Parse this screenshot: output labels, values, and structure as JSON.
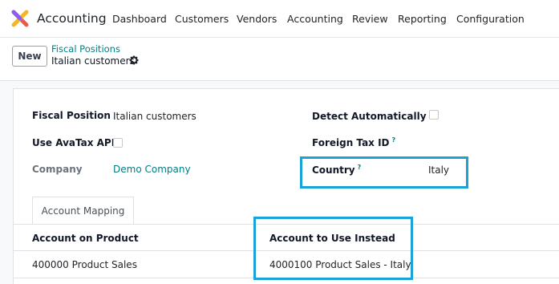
{
  "navbar": {
    "app_name": "Accounting",
    "menu": [
      "Dashboard",
      "Customers",
      "Vendors",
      "Accounting",
      "Review",
      "Reporting",
      "Configuration"
    ]
  },
  "control": {
    "new_label": "New",
    "breadcrumb_parent": "Fiscal Positions",
    "breadcrumb_current": "Italian customers"
  },
  "form": {
    "fiscal_position_label": "Fiscal Position",
    "fiscal_position_value": "Italian customers",
    "use_avatax_label": "Use AvaTax API",
    "company_label": "Company",
    "company_value": "Demo Company",
    "detect_auto_label": "Detect Automatically",
    "foreign_tax_label": "Foreign Tax ID",
    "country_label": "Country",
    "country_value": "Italy",
    "help_marker": "?"
  },
  "tabs": [
    "Account Mapping"
  ],
  "table": {
    "columns": [
      "Account on Product",
      "Account to Use Instead"
    ],
    "rows": [
      [
        "400000 Product Sales",
        "4000100 Product Sales - Italy"
      ]
    ]
  },
  "colors": {
    "brand_link": "#017e84",
    "highlight": "#1aa3d6"
  }
}
